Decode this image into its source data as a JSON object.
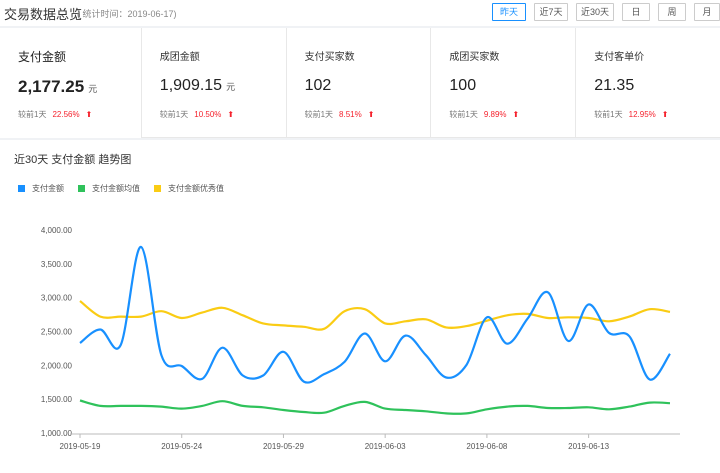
{
  "header": {
    "title": "交易数据总览",
    "subtitle": "( 统计时间：2019-06-17)",
    "range_buttons": [
      {
        "label": "昨天",
        "active": true
      },
      {
        "label": "近7天",
        "active": false
      },
      {
        "label": "近30天",
        "active": false
      },
      {
        "label": "日",
        "active": false
      },
      {
        "label": "周",
        "active": false
      },
      {
        "label": "月",
        "active": false
      }
    ]
  },
  "metrics": [
    {
      "label": "支付金额",
      "value": "2,177.25",
      "unit": "元",
      "compare_label": "较前1天",
      "change": "22.56%",
      "trend": "up"
    },
    {
      "label": "成团金额",
      "value": "1,909.15",
      "unit": "元",
      "compare_label": "较前1天",
      "change": "10.50%",
      "trend": "up"
    },
    {
      "label": "支付买家数",
      "value": "102",
      "unit": "",
      "compare_label": "较前1天",
      "change": "8.51%",
      "trend": "up"
    },
    {
      "label": "成团买家数",
      "value": "100",
      "unit": "",
      "compare_label": "较前1天",
      "change": "9.89%",
      "trend": "up"
    },
    {
      "label": "支付客单价",
      "value": "21.35",
      "unit": "",
      "compare_label": "较前1天",
      "change": "12.95%",
      "trend": "up"
    }
  ],
  "colors": {
    "accent": "#1890ff",
    "up": "#f5222d"
  },
  "chart_data": {
    "type": "line",
    "title": "近30天 支付金额 趋势图",
    "legend_position": "top-left",
    "grid": false,
    "ylim": [
      1000,
      4000
    ],
    "yticks": [
      "1,000.00",
      "1,500.00",
      "2,000.00",
      "2,500.00",
      "3,000.00",
      "3,500.00",
      "4,000.00"
    ],
    "xticks": [
      "2019-05-19",
      "2019-05-24",
      "2019-05-29",
      "2019-06-03",
      "2019-06-08",
      "2019-06-13"
    ],
    "x": [
      "2019-05-19",
      "2019-05-20",
      "2019-05-21",
      "2019-05-22",
      "2019-05-23",
      "2019-05-24",
      "2019-05-25",
      "2019-05-26",
      "2019-05-27",
      "2019-05-28",
      "2019-05-29",
      "2019-05-30",
      "2019-05-31",
      "2019-06-01",
      "2019-06-02",
      "2019-06-03",
      "2019-06-04",
      "2019-06-05",
      "2019-06-06",
      "2019-06-07",
      "2019-06-08",
      "2019-06-09",
      "2019-06-10",
      "2019-06-11",
      "2019-06-12",
      "2019-06-13",
      "2019-06-14",
      "2019-06-15",
      "2019-06-16",
      "2019-06-17"
    ],
    "series": [
      {
        "name": "支付金额",
        "color": "#1890ff",
        "values": [
          2330,
          2530,
          2300,
          3750,
          2150,
          1990,
          1800,
          2260,
          1850,
          1850,
          2200,
          1760,
          1870,
          2050,
          2470,
          2060,
          2440,
          2150,
          1820,
          2010,
          2710,
          2320,
          2690,
          3080,
          2360,
          2900,
          2480,
          2430,
          1790,
          2170
        ]
      },
      {
        "name": "支付金额均值",
        "color": "#2fc25b",
        "values": [
          1480,
          1400,
          1400,
          1400,
          1390,
          1360,
          1400,
          1470,
          1400,
          1380,
          1340,
          1310,
          1300,
          1400,
          1460,
          1360,
          1340,
          1320,
          1290,
          1290,
          1350,
          1390,
          1400,
          1370,
          1370,
          1380,
          1350,
          1390,
          1450,
          1440
        ]
      },
      {
        "name": "支付金额优秀值",
        "color": "#facc14",
        "values": [
          2950,
          2720,
          2720,
          2720,
          2800,
          2700,
          2780,
          2850,
          2740,
          2620,
          2590,
          2570,
          2540,
          2800,
          2830,
          2620,
          2650,
          2680,
          2560,
          2580,
          2660,
          2740,
          2760,
          2700,
          2710,
          2700,
          2650,
          2720,
          2830,
          2790
        ]
      }
    ]
  }
}
